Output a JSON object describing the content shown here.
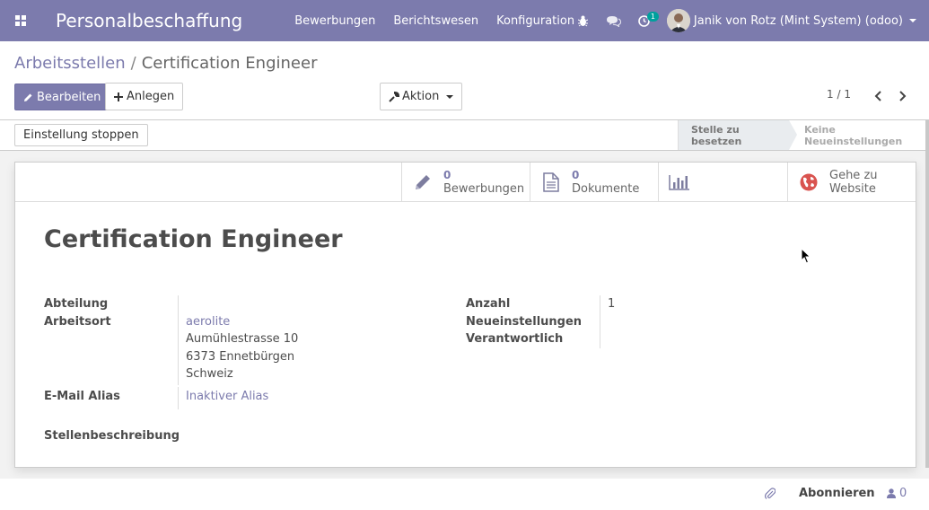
{
  "navbar": {
    "app_title": "Personalbeschaffung",
    "menu": [
      "Bewerbungen",
      "Berichtswesen",
      "Konfiguration"
    ],
    "activity_count": "1",
    "user_name": "Janik von Rotz (Mint System) (odoo)",
    "color": "#7c7bad"
  },
  "breadcrumb": {
    "parent": "Arbeitsstellen",
    "separator": "/",
    "current": "Certification Engineer"
  },
  "toolbar": {
    "edit_label": "Bearbeiten",
    "create_label": "Anlegen",
    "action_label": "Aktion",
    "pager": "1 / 1"
  },
  "statusbar": {
    "stop_label": "Einstellung stoppen",
    "stage_active": "Stelle zu besetzen",
    "stage_inactive": "Keine Neueinstellungen"
  },
  "stat_buttons": {
    "applications_value": "0",
    "applications_label": "Bewerbungen",
    "documents_value": "0",
    "documents_label": "Dokumente",
    "website_label_1": "Gehe zu",
    "website_label_2": "Website"
  },
  "form": {
    "title": "Certification Engineer",
    "department_label": "Abteilung",
    "department_value": "",
    "location_label": "Arbeitsort",
    "location_company": "aerolite",
    "location_street": "Aumühlestrasse 10",
    "location_city": "6373 Ennetbürgen",
    "location_country": "Schweiz",
    "alias_label": "E-Mail Alias",
    "alias_value": "Inaktiver Alias",
    "count_label": "Anzahl",
    "count_value": "1",
    "new_hires_label": "Neueinstellungen",
    "responsible_label": "Verantwortlich",
    "description_label": "Stellenbeschreibung"
  },
  "chatter": {
    "follow_label": "Abonnieren",
    "followers_count": "0"
  }
}
